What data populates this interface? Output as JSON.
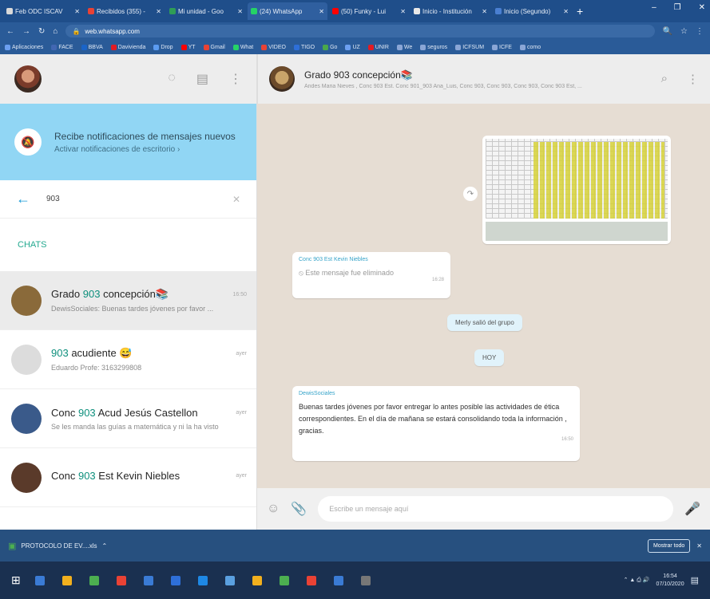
{
  "browser": {
    "tabs": [
      {
        "label": "Feb ODC ISCAV",
        "color": "#d9d9d9",
        "active": false
      },
      {
        "label": "Recibidos (355) -",
        "color": "#e94235",
        "active": false
      },
      {
        "label": "Mi unidad - Goo",
        "color": "#2f9d56",
        "active": false
      },
      {
        "label": "(24) WhatsApp",
        "color": "#25d366",
        "active": true
      },
      {
        "label": "(50) Funky - Lui",
        "color": "#ff0000",
        "active": false
      },
      {
        "label": "Inicio - Institución",
        "color": "#e8e8e8",
        "active": false
      },
      {
        "label": "Inicio (Segundo)",
        "color": "#4a7fd1",
        "active": false
      }
    ],
    "url": "web.whatsapp.com",
    "bookmarks": [
      {
        "label": "Aplicaciones",
        "color": "#6c9ff0"
      },
      {
        "label": "FACE",
        "color": "#4267b2"
      },
      {
        "label": "BBVA",
        "color": "#1a64c8"
      },
      {
        "label": "Davivienda",
        "color": "#e21b23"
      },
      {
        "label": "Drop",
        "color": "#5b9bf0"
      },
      {
        "label": "YT",
        "color": "#ff0000"
      },
      {
        "label": "Gmail",
        "color": "#e94235"
      },
      {
        "label": "What",
        "color": "#25d366"
      },
      {
        "label": "VIDEO",
        "color": "#e94235"
      },
      {
        "label": "TIGO",
        "color": "#2e6fd8"
      },
      {
        "label": "Go",
        "color": "#4aa84a"
      },
      {
        "label": "UZ",
        "color": "#6c9ff0"
      },
      {
        "label": "UNIR",
        "color": "#e21b23"
      },
      {
        "label": "We",
        "color": "#8aa6d6"
      },
      {
        "label": "seguros",
        "color": "#8aa6d6"
      },
      {
        "label": "ICFSUM",
        "color": "#8aa6d6"
      },
      {
        "label": "ICFE",
        "color": "#8aa6d6"
      },
      {
        "label": "como",
        "color": "#8aa6d6"
      }
    ]
  },
  "left": {
    "notify_title": "Recibe notificaciones de mensajes nuevos",
    "notify_link": "Activar notificaciones de escritorio ›",
    "search_query": "903",
    "chats_label": "CHATS",
    "chats": [
      {
        "name_pre": "Grado ",
        "name_hl": "903",
        "name_post": " concepción📚",
        "time": "16:50",
        "preview": "DewisSociales: Buenas tardes jóvenes por favor ...",
        "avatar": "#8a6a3a",
        "selected": true
      },
      {
        "name_pre": "",
        "name_hl": "903",
        "name_post": " acudiente 😅",
        "time": "ayer",
        "preview": "Eduardo Profe: 3163299808",
        "avatar": "#dcdcdc",
        "selected": false
      },
      {
        "name_pre": "Conc ",
        "name_hl": "903",
        "name_post": " Acud Jesús Castellon",
        "time": "ayer",
        "preview": "Se les manda las guías a matemática y ni la ha visto",
        "avatar": "#3a5a8a",
        "selected": false
      },
      {
        "name_pre": "Conc ",
        "name_hl": "903",
        "name_post": " Est Kevin Niebles",
        "time": "ayer",
        "preview": "",
        "avatar": "#5a3a2a",
        "selected": false
      }
    ]
  },
  "right": {
    "title": "Grado 903 concepción📚",
    "subtitle": "Andes Maria Nieves , Conc 903 Est. Conc 901_903 Ana_Luis, Conc 903, Conc 903, Conc 903, Conc 903 Est, ...",
    "msg1_sender": "Conc 903 Est Kevin Niebles",
    "msg1_text": "Este mensaje fue eliminado",
    "msg1_time": "16:28",
    "sys1": "Merly salió del grupo",
    "sys2": "HOY",
    "msg2_sender": "DewisSociales",
    "msg2_text": "Buenas tardes jóvenes por favor entregar lo antes posible las actividades de ética correspondientes. En el día de mañana se estará consolidando toda la información , gracias.",
    "msg2_time": "16:50",
    "composer_placeholder": "Escribe un mensaje aquí"
  },
  "downloads": {
    "filename": "PROTOCOLO DE EV....xls",
    "show_all": "Mostrar todo"
  },
  "taskbar": {
    "apps": [
      "#3a7bd5",
      "#f2b01e",
      "#4caf50",
      "#e94235",
      "#3a7bd5",
      "#2e6fd8",
      "#1e88e5",
      "#5aa0e0",
      "#f2b01e",
      "#4caf50",
      "#e94235",
      "#3a7bd5",
      "#777777"
    ],
    "time": "16:54",
    "date": "07/10/2020"
  }
}
